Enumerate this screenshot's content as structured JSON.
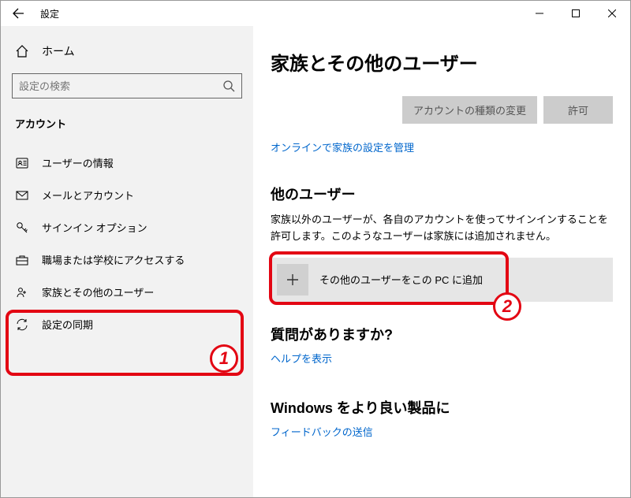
{
  "window": {
    "title": "設定"
  },
  "sidebar": {
    "home": "ホーム",
    "search_placeholder": "設定の検索",
    "section": "アカウント",
    "items": [
      {
        "label": "ユーザーの情報"
      },
      {
        "label": "メールとアカウント"
      },
      {
        "label": "サインイン オプション"
      },
      {
        "label": "職場または学校にアクセスする"
      },
      {
        "label": "家族とその他のユーザー"
      },
      {
        "label": "設定の同期"
      }
    ]
  },
  "main": {
    "title": "家族とその他のユーザー",
    "button_change_type": "アカウントの種類の変更",
    "button_allow": "許可",
    "manage_link": "オンラインで家族の設定を管理",
    "other_users": {
      "title": "他のユーザー",
      "desc": "家族以外のユーザーが、各自のアカウントを使ってサインインすることを許可します。このようなユーザーは家族には追加されません。",
      "add_label": "その他のユーザーをこの PC に追加"
    },
    "question": {
      "title": "質問がありますか?",
      "link": "ヘルプを表示"
    },
    "better": {
      "title": "Windows をより良い製品に",
      "link": "フィードバックの送信"
    }
  },
  "annotations": {
    "one": "1",
    "two": "2"
  }
}
